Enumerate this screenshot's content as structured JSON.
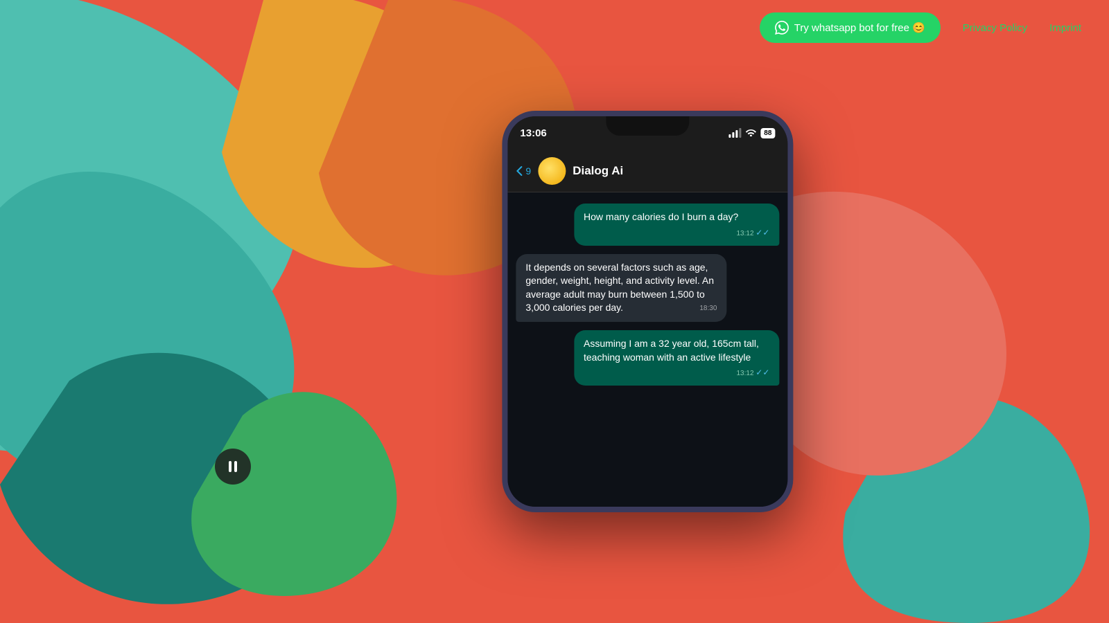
{
  "background": {
    "base_color": "#e85540"
  },
  "nav": {
    "whatsapp_btn_label": "Try whatsapp bot for free 😊",
    "privacy_policy_label": "Privacy Policy",
    "imprint_label": "Imprint"
  },
  "phone": {
    "status_bar": {
      "time": "13:06",
      "battery": "88"
    },
    "chat_header": {
      "back_label": "9",
      "contact_name": "Dialog Ai"
    },
    "messages": [
      {
        "type": "sent",
        "text": "How many calories do I burn a day?",
        "time": "13:12",
        "read": true
      },
      {
        "type": "received",
        "text": "It depends on several factors such as age, gender, weight, height, and activity level. An average adult may burn between 1,500 to 3,000 calories per day.",
        "time": "18:30"
      },
      {
        "type": "sent",
        "text": "Assuming I am a 32 year old, 165cm tall, teaching woman with an active lifestyle",
        "time": "13:12",
        "read": true
      }
    ]
  }
}
